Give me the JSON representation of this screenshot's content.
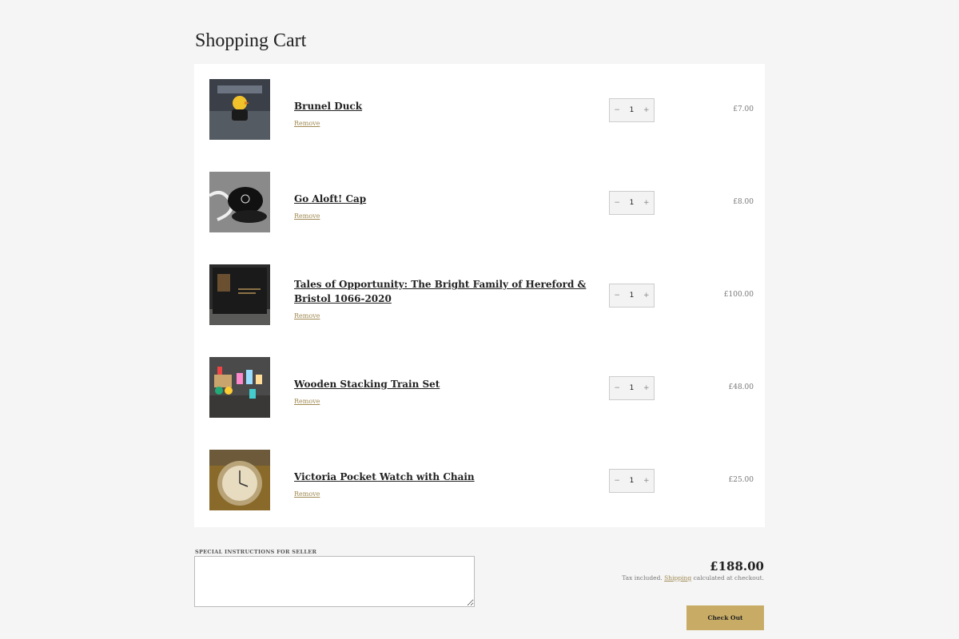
{
  "page": {
    "title": "Shopping Cart"
  },
  "cart": {
    "remove_label": "Remove",
    "items": [
      {
        "title": "Brunel Duck",
        "quantity": "1",
        "price": "£7.00",
        "thumb": "duck-photo-icon"
      },
      {
        "title": "Go Aloft! Cap",
        "quantity": "1",
        "price": "£8.00",
        "thumb": "cap-photo-icon"
      },
      {
        "title": "Tales of Opportunity: The Bright Family of Hereford & Bristol 1066-2020",
        "quantity": "1",
        "price": "£100.00",
        "thumb": "book-photo-icon"
      },
      {
        "title": "Wooden Stacking Train Set",
        "quantity": "1",
        "price": "£48.00",
        "thumb": "train-set-photo-icon"
      },
      {
        "title": "Victoria Pocket Watch with Chain",
        "quantity": "1",
        "price": "£25.00",
        "thumb": "pocket-watch-photo-icon"
      }
    ],
    "qty_minus": "−",
    "qty_plus": "+"
  },
  "footer": {
    "instructions_label": "SPECIAL INSTRUCTIONS FOR SELLER",
    "instructions_value": "",
    "total": "£188.00",
    "tax_prefix": "Tax included.",
    "shipping_link": "Shipping",
    "tax_suffix": "calculated at checkout.",
    "checkout_label": "Check Out"
  },
  "colors": {
    "accent": "#c8ac66",
    "link": "#a08a53",
    "background": "#f5f5f5"
  }
}
